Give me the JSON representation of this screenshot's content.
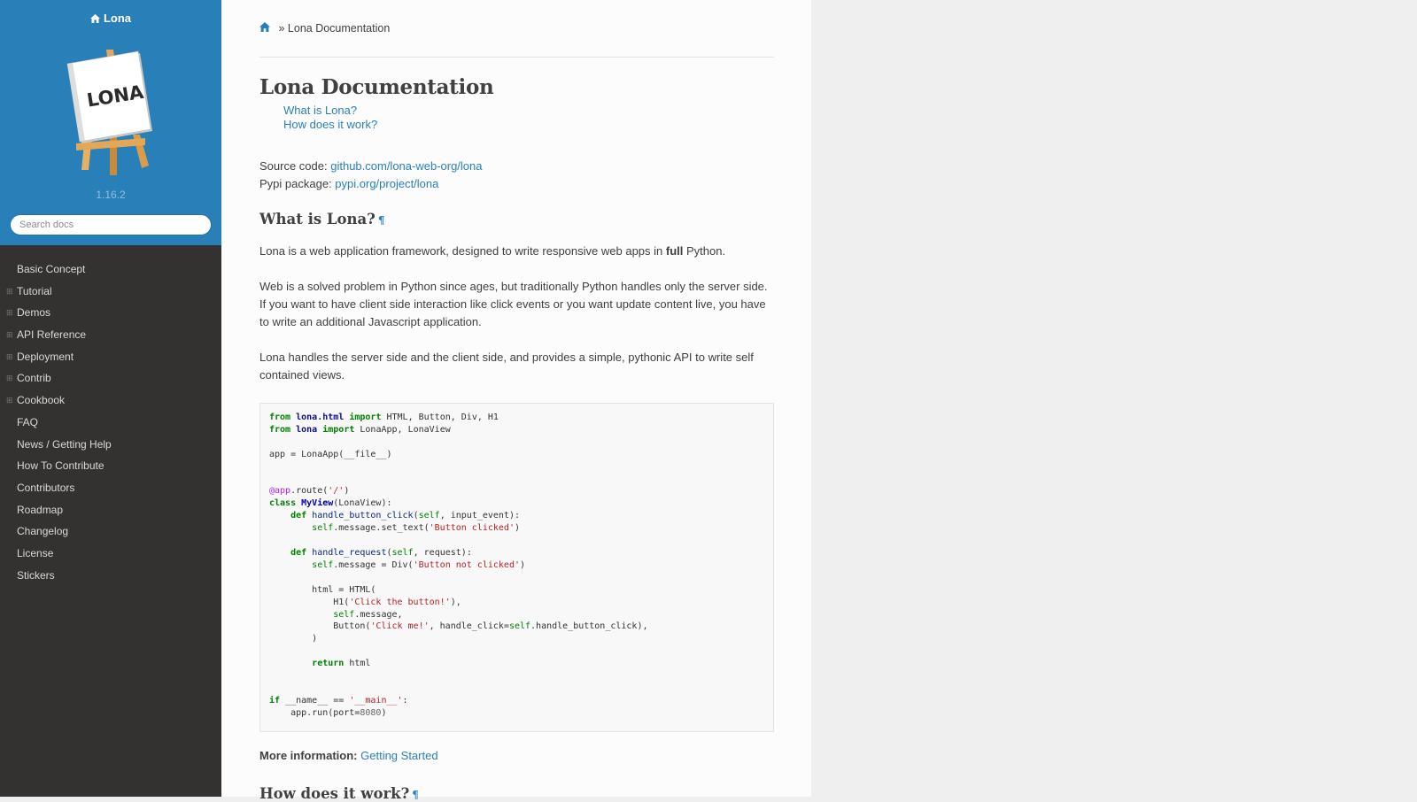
{
  "sidebar": {
    "brand": "Lona",
    "logo_text": "LONA",
    "version": "1.16.2",
    "search_placeholder": "Search docs",
    "items": [
      {
        "label": "Basic Concept",
        "expandable": false
      },
      {
        "label": "Tutorial",
        "expandable": true
      },
      {
        "label": "Demos",
        "expandable": true
      },
      {
        "label": "API Reference",
        "expandable": true
      },
      {
        "label": "Deployment",
        "expandable": true
      },
      {
        "label": "Contrib",
        "expandable": true
      },
      {
        "label": "Cookbook",
        "expandable": true
      },
      {
        "label": "FAQ",
        "expandable": false
      },
      {
        "label": "News / Getting Help",
        "expandable": false
      },
      {
        "label": "How To Contribute",
        "expandable": false
      },
      {
        "label": "Contributors",
        "expandable": false
      },
      {
        "label": "Roadmap",
        "expandable": false
      },
      {
        "label": "Changelog",
        "expandable": false
      },
      {
        "label": "License",
        "expandable": false
      },
      {
        "label": "Stickers",
        "expandable": false
      }
    ]
  },
  "breadcrumb": {
    "separator": "»",
    "current": "Lona Documentation"
  },
  "page": {
    "title": "Lona Documentation",
    "toc": [
      "What is Lona?",
      "How does it work?"
    ],
    "source_code_label": "Source code:",
    "source_code_link": "github.com/lona-web-org/lona",
    "pypi_label": "Pypi package:",
    "pypi_link": "pypi.org/project/lona",
    "section1_title": "What is Lona?",
    "pilcrow": "¶",
    "para1_before": "Lona is a web application framework, designed to write responsive web apps in ",
    "para1_bold": "full",
    "para1_after": " Python.",
    "para2": "Web is a solved problem in Python since ages, but traditionally Python handles only the server side. If you want to have client side interaction like click events or you want update content live, you have to write an additional Javascript application.",
    "para3": "Lona handles the server side and the client side, and provides a simple, pythonic API to write self contained views.",
    "more_label": "More information:",
    "more_link": "Getting Started",
    "section2_title": "How does it work?"
  },
  "colors": {
    "accent": "#2980b9",
    "sidebar_bg": "#343131",
    "content_bg": "#fcfcfc"
  }
}
